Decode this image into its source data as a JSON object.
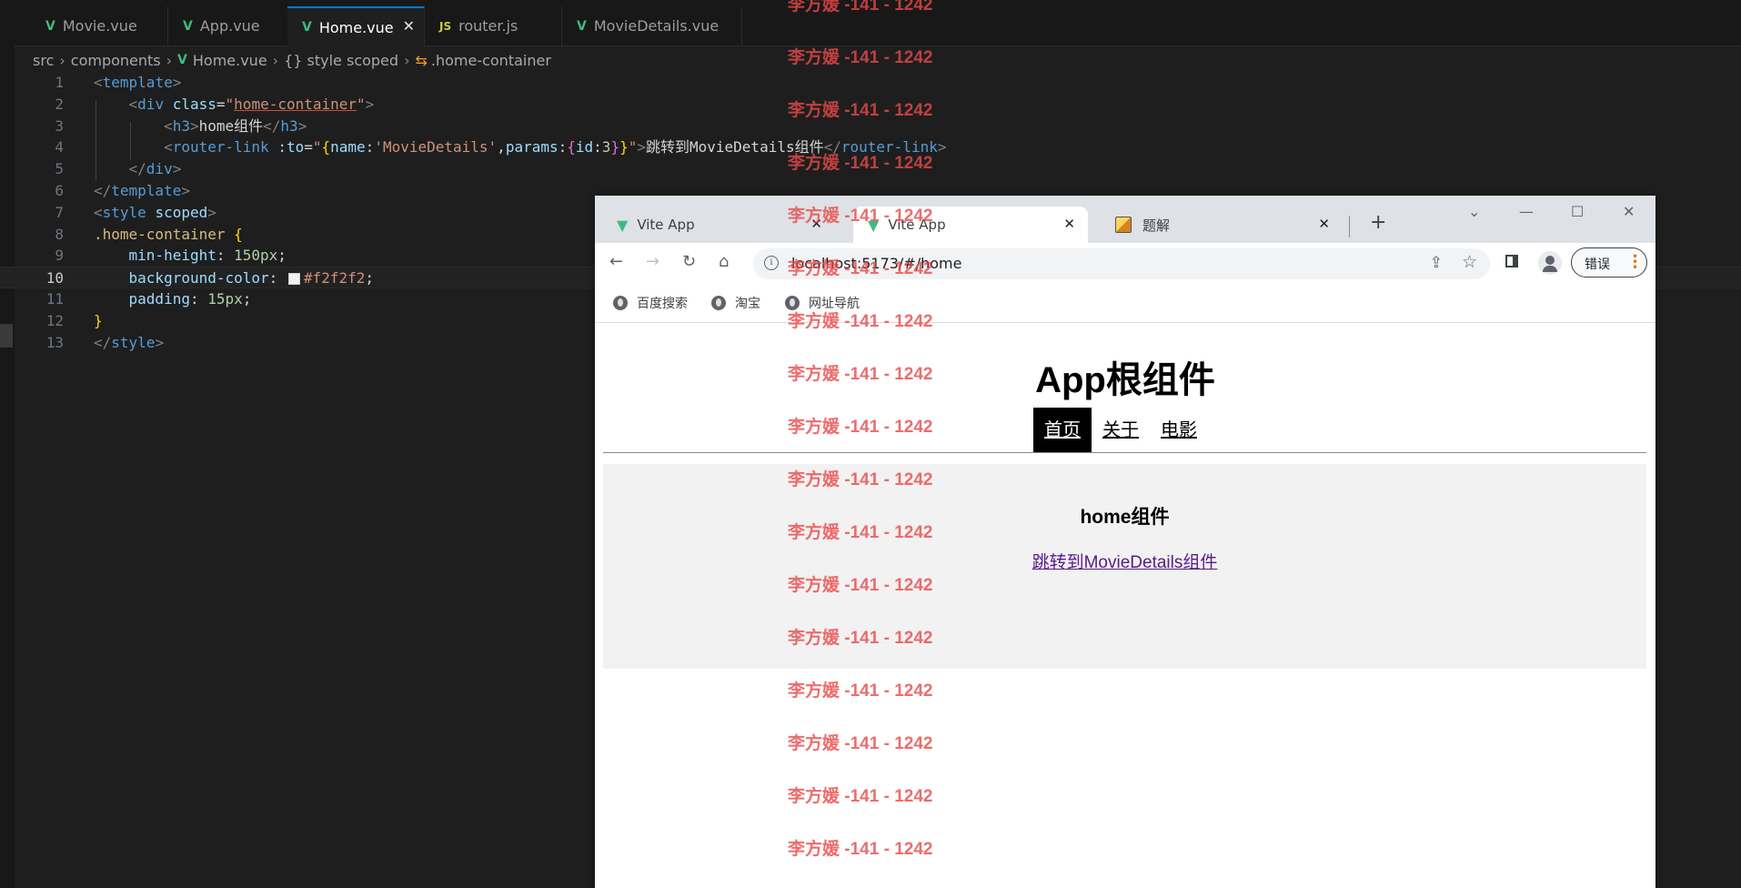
{
  "editor": {
    "tabs": [
      {
        "label": "Movie.vue",
        "icon": "vue-icon"
      },
      {
        "label": "App.vue",
        "icon": "vue-icon"
      },
      {
        "label": "Home.vue",
        "icon": "vue-icon",
        "active": true
      },
      {
        "label": "router.js",
        "icon": "js-icon"
      },
      {
        "label": "MovieDetails.vue",
        "icon": "vue-icon"
      }
    ],
    "tab_icon_js": "JS",
    "close_glyph": "✕",
    "breadcrumb": {
      "src": "src",
      "components": "components",
      "file": "Home.vue",
      "scope": "{} style scoped",
      "selector": ".home-container"
    },
    "line_numbers": [
      "1",
      "2",
      "3",
      "4",
      "5",
      "6",
      "7",
      "8",
      "9",
      "10",
      "11",
      "12",
      "13"
    ],
    "current_line": "10",
    "code": {
      "l1_tag": "template",
      "l2_tag": "div",
      "l2_attr": "class",
      "l2_val": "home-container",
      "l3_tag": "h3",
      "l3_text": "home组件",
      "l4_tag": "router-link",
      "l4_attr": ":to",
      "l4_name_key": "name",
      "l4_name_val": "'MovieDetails'",
      "l4_params_key": "params",
      "l4_id_key": "id",
      "l4_id_val": "3",
      "l4_text": "跳转到MovieDetails组件",
      "l5_tag": "div",
      "l6_tag": "template",
      "l7_tag": "style",
      "l7_attr": "scoped",
      "l8_selector": ".home-container",
      "l9_prop": "min-height",
      "l9_val": "150px",
      "l10_prop": "background-color",
      "l10_val": "#f2f2f2",
      "l11_prop": "padding",
      "l11_val": "15px",
      "l13_tag": "style"
    }
  },
  "browser": {
    "tabs": [
      {
        "label": "Vite App",
        "icon": "vue-icon"
      },
      {
        "label": "Vite App",
        "icon": "vue-icon",
        "active": true
      },
      {
        "label": "题解",
        "icon": "image-icon"
      }
    ],
    "new_tab": "+",
    "url": "localhost:5173/#/home",
    "error_button": "错误",
    "bookmarks": [
      "百度搜索",
      "淘宝",
      "网址导航"
    ],
    "page": {
      "title": "App根组件",
      "nav": [
        "首页",
        "关于",
        "电影"
      ],
      "active_nav": "首页",
      "home_heading": "home组件",
      "home_link": "跳转到MovieDetails组件"
    }
  },
  "watermark": {
    "text": "李方媛 -141 - 1242",
    "color": "#e84848"
  }
}
